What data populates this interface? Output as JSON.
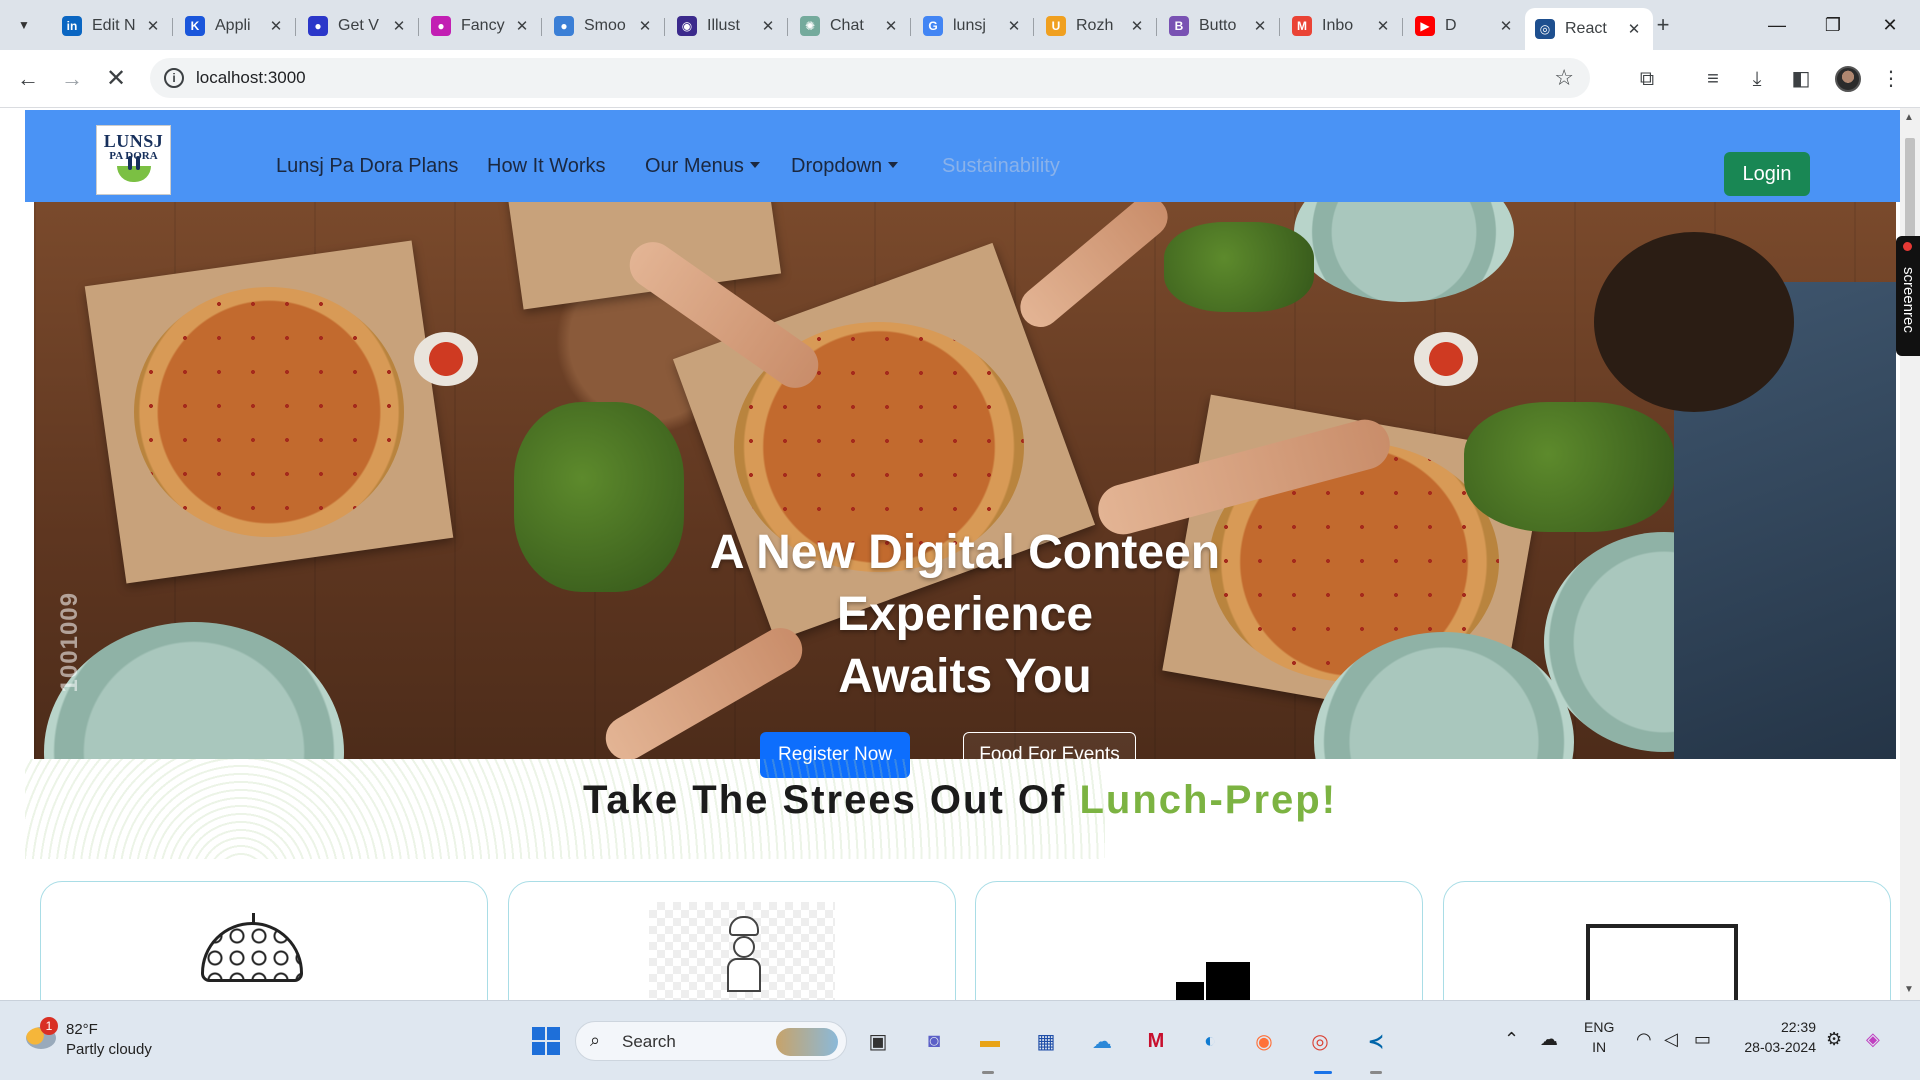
{
  "browser": {
    "tabs": [
      {
        "title": "Edit N",
        "favicon": "linkedin-icon",
        "color": "#0a66c2",
        "glyph": "in"
      },
      {
        "title": "Appli",
        "favicon": "k-icon",
        "color": "#1a56db",
        "glyph": "K"
      },
      {
        "title": "Get V",
        "favicon": "globe-icon",
        "color": "#2b37c9",
        "glyph": "●"
      },
      {
        "title": "Fancy",
        "favicon": "fancy-icon",
        "color": "#c21fb3",
        "glyph": "●"
      },
      {
        "title": "Smoo",
        "favicon": "smoo-icon",
        "color": "#3b7fd6",
        "glyph": "●"
      },
      {
        "title": "Illust",
        "favicon": "illust-icon",
        "color": "#3b2a8c",
        "glyph": "◉"
      },
      {
        "title": "Chat",
        "favicon": "chatgpt-icon",
        "color": "#74aa9c",
        "glyph": "✺"
      },
      {
        "title": "lunsj",
        "favicon": "google-icon",
        "color": "#4285f4",
        "glyph": "G"
      },
      {
        "title": "Rozh",
        "favicon": "u-icon",
        "color": "#f0a020",
        "glyph": "U"
      },
      {
        "title": "Butto",
        "favicon": "bootstrap-icon",
        "color": "#7952b3",
        "glyph": "B"
      },
      {
        "title": "Inbo",
        "favicon": "gmail-icon",
        "color": "#ea4335",
        "glyph": "M"
      },
      {
        "title": "D",
        "favicon": "youtube-icon",
        "color": "#ff0000",
        "glyph": "▶"
      },
      {
        "title": "React",
        "favicon": "react-icon",
        "color": "#1e4f8f",
        "glyph": "◎"
      }
    ],
    "url": "localhost:3000"
  },
  "site": {
    "logo_line1": "LUNSJ",
    "logo_line2": "PA DORA",
    "nav": [
      "Lunsj Pa Dora Plans",
      "How It Works",
      "Our Menus",
      "Dropdown",
      "Sustainability"
    ],
    "login": "Login",
    "hero_line1": "A New Digital Conteen",
    "hero_line2": "Experience",
    "hero_line3": "Awaits You",
    "register": "Register Now",
    "food_events": "Food For Events",
    "watermark": "1001009",
    "section_title_main": "Take The Strees Out Of",
    "section_title_accent": "Lunch-Prep!",
    "accent_color": "#7cb342",
    "nav_color": "#4a93f5",
    "login_color": "#198754",
    "register_color": "#0d6efd",
    "screenrec": "screenrec"
  },
  "taskbar": {
    "weather_temp": "82°F",
    "weather_cond": "Partly cloudy",
    "weather_badge": "1",
    "search": "Search",
    "lang_line1": "ENG",
    "lang_line2": "IN",
    "time": "22:39",
    "date": "28-03-2024"
  }
}
